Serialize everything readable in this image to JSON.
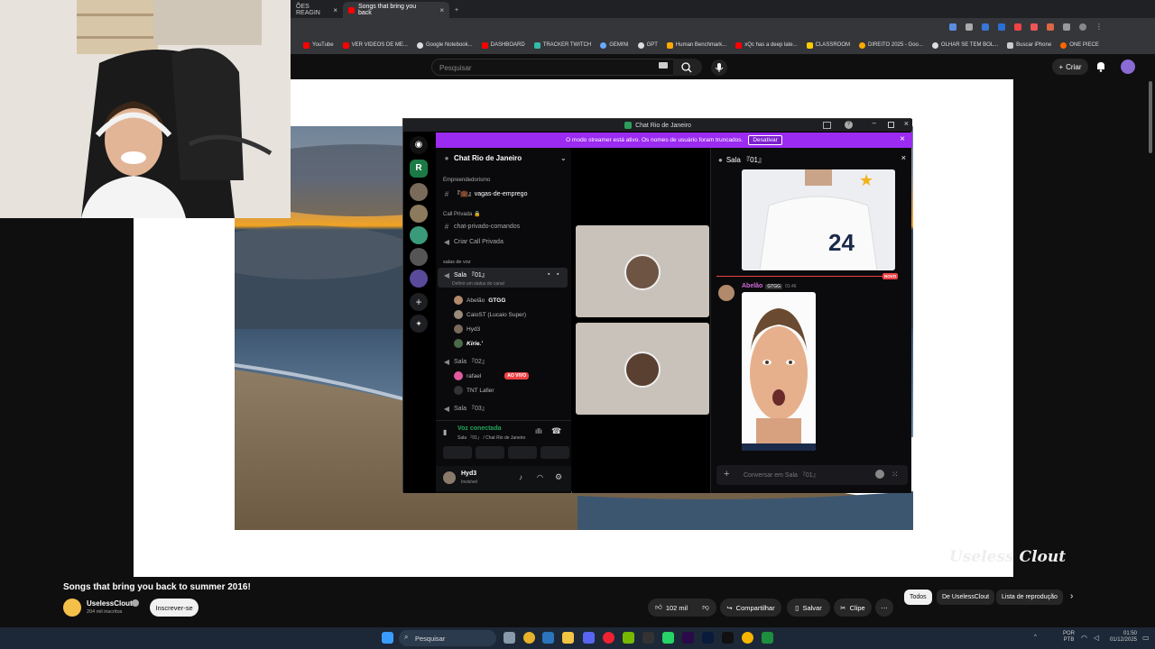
{
  "browser": {
    "tabs": [
      {
        "label": "ÕES REAGIN",
        "active": false
      },
      {
        "label": "Songs that bring you back",
        "active": true
      }
    ],
    "bookmarks": [
      "YouTube",
      "VER VIDEOS DE ME...",
      "Google Notebook...",
      "DASHBOARD",
      "TRACKER TWITCH",
      "GEMINI",
      "GPT",
      "Human Benchmark...",
      "xQc has a deep late...",
      "CLASSROOM",
      "DIREITO 2025 - Goo...",
      "OLHAR SE TEM BOL...",
      "Buscar iPhone",
      "ONE PIECE"
    ]
  },
  "youtube": {
    "search_placeholder": "Pesquisar",
    "create_label": "Criar",
    "video_title": "Songs that bring you back to summer 2016!",
    "channel_name": "UselessClout",
    "subscribers": "204 mil inscritos",
    "subscribe_label": "Inscrever-se",
    "likes": "102 mil",
    "share_label": "Compartilhar",
    "save_label": "Salvar",
    "clip_label": "Clipe",
    "watermark": "Useless Clout",
    "chips": [
      "Todos",
      "De UselessClout",
      "Lista de reprodução"
    ]
  },
  "discord": {
    "window_title": "Chat Rio de Janeiro",
    "banner_text": "O modo streamer está ativo. Os nomes de usuário foram truncados.",
    "banner_button": "Desativar",
    "server_name": "Chat Rio de Janeiro",
    "channels": {
      "cat1": "Empreendedorismo",
      "vagas": "『💼』vagas-de-emprego",
      "cat2": "Call Privada 🔒",
      "chat_privado": "chat-privado-comandos",
      "criar_call": "Criar Call Privada",
      "cat3": "salas de voz",
      "sala01": "Sala 『01』",
      "sala01_status": "Definir um status do canal",
      "sala02": "Sala 『02』",
      "sala03": "Sala 『03』"
    },
    "sala01_users": [
      "Abelão",
      "CaioST (Lucaio Super)",
      "Hyd3",
      "Kirie.'"
    ],
    "abelao_tag": "GTGG",
    "sala02_users": [
      "rafael",
      "TNT Lafier"
    ],
    "live_badge": "AO VIVO",
    "voice_status": "Voz conectada",
    "voice_location": "Sala 『01』 / Chat Rio de Janeiro",
    "current_user": "Hyd3",
    "current_user_status": "Invisível",
    "chat_header": "Sala 『01』",
    "new_badge": "NOVO",
    "message_author": "Abelão",
    "message_tag": "GTGG",
    "message_time": "01:46",
    "jersey_number": "24",
    "input_placeholder": "Conversar em Sala 『01』"
  },
  "taskbar": {
    "search_label": "Pesquisar",
    "lang": "POR",
    "lang2": "PTB",
    "time": "01:50",
    "date": "01/12/2025"
  },
  "colors": {
    "discord_banner": "#9b2bf0",
    "voice_green": "#23a55a",
    "live_red": "#ed4245",
    "youtube_bg": "#0f0f0f"
  }
}
